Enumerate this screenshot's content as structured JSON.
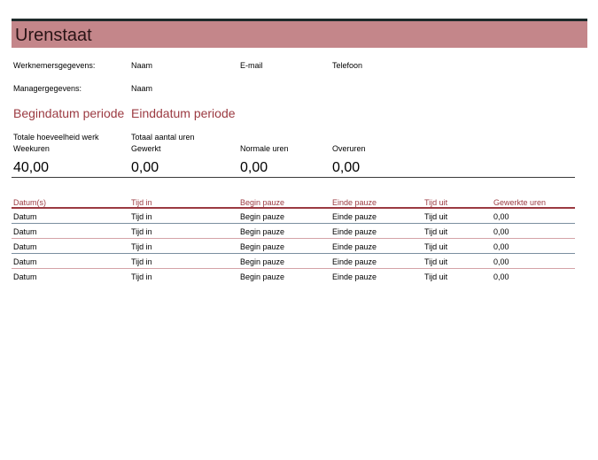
{
  "title": "Urenstaat",
  "employee": {
    "label": "Werknemersgegevens:",
    "name_label": "Naam",
    "email_label": "E-mail",
    "phone_label": "Telefoon"
  },
  "manager": {
    "label": "Managergegevens:",
    "name_label": "Naam"
  },
  "period": {
    "start": "Begindatum periode",
    "end": "Einddatum periode"
  },
  "summary": {
    "week_hours": {
      "label1": "Totale hoeveelheid werk",
      "label2": "Weekuren",
      "value": "40,00"
    },
    "worked_total": {
      "label1": "Totaal aantal uren",
      "label2": "Gewerkt",
      "value": "0,00"
    },
    "normal_hours": {
      "label": "Normale uren",
      "value": "0,00"
    },
    "overtime": {
      "label": "Overuren",
      "value": "0,00"
    }
  },
  "table": {
    "headers": [
      "Datum(s)",
      "Tijd in",
      "Begin pauze",
      "Einde pauze",
      "Tijd uit",
      "Gewerkte uren"
    ],
    "rows": [
      [
        "Datum",
        "Tijd in",
        "Begin pauze",
        "Einde pauze",
        "Tijd uit",
        "0,00"
      ],
      [
        "Datum",
        "Tijd in",
        "Begin pauze",
        "Einde pauze",
        "Tijd uit",
        "0,00"
      ],
      [
        "Datum",
        "Tijd in",
        "Begin pauze",
        "Einde pauze",
        "Tijd uit",
        "0,00"
      ],
      [
        "Datum",
        "Tijd in",
        "Begin pauze",
        "Einde pauze",
        "Tijd uit",
        "0,00"
      ],
      [
        "Datum",
        "Tijd in",
        "Begin pauze",
        "Einde pauze",
        "Tijd uit",
        "0,00"
      ]
    ],
    "row_line_colors": [
      "#7b8fa0",
      "#d4a3a7",
      "#7b8fa0",
      "#d4a3a7",
      "none"
    ]
  },
  "colors": {
    "title_bar": "#c4868a",
    "accent_red": "#9b3a41",
    "top_rule": "#1f2b2b"
  }
}
